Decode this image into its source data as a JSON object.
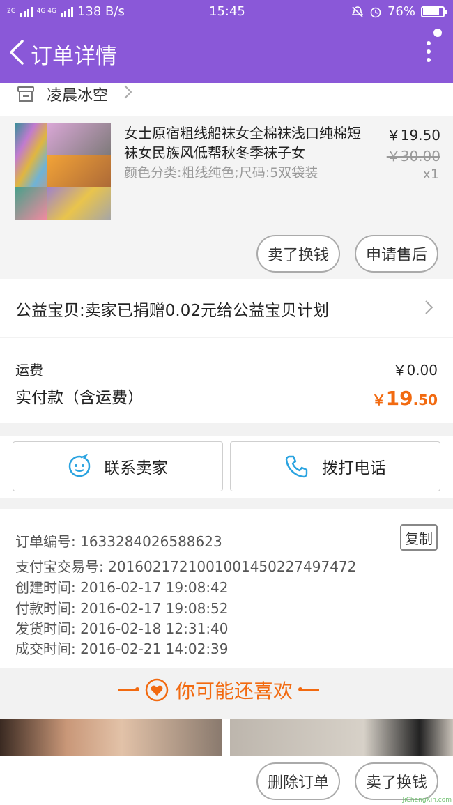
{
  "status_bar": {
    "net1": "2G",
    "net2": "4G 4G",
    "speed": "138 B/s",
    "time": "15:45",
    "battery": "76%"
  },
  "header": {
    "title": "订单详情"
  },
  "shop": {
    "name": "凌晨冰空"
  },
  "product": {
    "title": "女士原宿粗线船袜女全棉袜浅口纯棉短袜女民族风低帮秋冬季袜子女",
    "spec": "颜色分类:粗线纯色;尺码:5双袋装",
    "price": "￥19.50",
    "original_price": "￥30.00",
    "quantity": "x1",
    "sell_button": "卖了换钱",
    "aftersale_button": "申请售后"
  },
  "charity": {
    "text": "公益宝贝:卖家已捐赠0.02元给公益宝贝计划"
  },
  "payment": {
    "shipping_label": "运费",
    "shipping_value": "￥0.00",
    "paid_label": "实付款（含运费）",
    "paid_currency": "￥",
    "paid_int": "19",
    "paid_dec": ".50"
  },
  "contact": {
    "seller_label": "联系卖家",
    "phone_label": "拨打电话"
  },
  "order_info": {
    "order_no": "订单编号: 1633284026588623",
    "alipay_no": "支付宝交易号: 2016021721001001450227497472",
    "created": "创建时间: 2016-02-17 19:08:42",
    "paid": "付款时间: 2016-02-17 19:08:52",
    "shipped": "发货时间: 2016-02-18 12:31:40",
    "completed": "成交时间: 2016-02-21 14:02:39",
    "copy_button": "复制"
  },
  "recommend": {
    "title": "你可能还喜欢"
  },
  "bottom": {
    "delete_button": "删除订单",
    "sell_button": "卖了换钱"
  },
  "watermark": "JiChengXin.com",
  "colors": {
    "header": "#8a58d8",
    "accent": "#f26a10",
    "icon_blue": "#2aa3e0"
  }
}
